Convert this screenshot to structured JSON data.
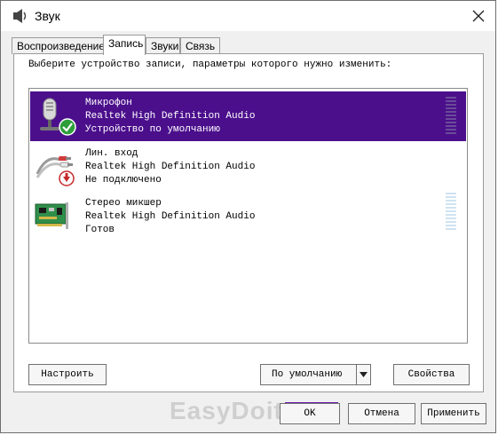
{
  "window": {
    "title": "Звук",
    "icon": "speaker-icon",
    "close_icon": "close-icon"
  },
  "tabs": [
    {
      "label": "Воспроизведение",
      "active": false
    },
    {
      "label": "Запись",
      "active": true
    },
    {
      "label": "Звуки",
      "active": false
    },
    {
      "label": "Связь",
      "active": false
    }
  ],
  "instruction": "Выберите устройство записи, параметры которого нужно изменить:",
  "devices": [
    {
      "name": "Микрофон",
      "driver": "Realtek High Definition Audio",
      "status": "Устройство по умолчанию",
      "selected": true,
      "icon": "microphone-icon",
      "badge": "default-check-icon"
    },
    {
      "name": "Лин. вход",
      "driver": "Realtek High Definition Audio",
      "status": "Не подключено",
      "selected": false,
      "icon": "line-in-cable-icon",
      "badge": "disconnected-arrow-icon"
    },
    {
      "name": "Стерео микшер",
      "driver": "Realtek High Definition Audio",
      "status": "Готов",
      "selected": false,
      "icon": "sound-card-icon"
    }
  ],
  "buttons": {
    "configure": "Настроить",
    "set_default": "По умолчанию",
    "properties": "Свойства",
    "ok": "OK",
    "cancel": "Отмена",
    "apply": "Применить"
  },
  "watermark": "EasyDoit.ru",
  "colors": {
    "selection": "#4b0f8c",
    "check_badge": "#2e9e3a",
    "disconnected_badge": "#c62828"
  }
}
